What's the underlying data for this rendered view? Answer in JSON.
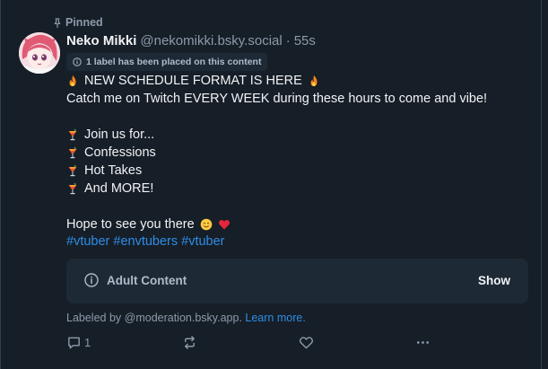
{
  "pinned_label": "Pinned",
  "author": {
    "display_name": "Neko Mikki",
    "handle": "@nekomikki.bsky.social",
    "separator": "·",
    "time": "55s"
  },
  "content_label": "1 label has been placed on this content",
  "post_lines": [
    {
      "emoji": "fire-emoji",
      "text": "NEW SCHEDULE FORMAT IS HERE",
      "trailing_emoji": "fire-emoji"
    },
    {
      "text": "Catch me on Twitch EVERY WEEK during these hours to come and vibe!"
    },
    {
      "emoji": "tropical-drink-emoji",
      "text": "Join us for..."
    },
    {
      "emoji": "tropical-drink-emoji",
      "text": "Confessions"
    },
    {
      "emoji": "tropical-drink-emoji",
      "text": "Hot Takes"
    },
    {
      "emoji": "tropical-drink-emoji",
      "text": "And MORE!"
    },
    {
      "text": "Hope to see you there",
      "trailing_emoji": "smiling-face-emoji",
      "trailing_emoji2": "red-heart-emoji"
    }
  ],
  "hashtags": [
    "#vtuber",
    "#envtubers",
    "#vtuber"
  ],
  "adult_content": {
    "label": "Adult Content",
    "show_label": "Show"
  },
  "labeled_by": {
    "text": "Labeled by @moderation.bsky.app.",
    "link": "Learn more."
  },
  "actions": {
    "reply_count": "1",
    "reply_icon": "reply-icon",
    "repost_icon": "repost-icon",
    "like_icon": "heart-icon",
    "more_icon": "more-icon"
  },
  "colors": {
    "background": "#161e27",
    "accent_link": "#2f8de6",
    "muted_text": "#8d9aab",
    "box_bg": "#1e2936"
  }
}
